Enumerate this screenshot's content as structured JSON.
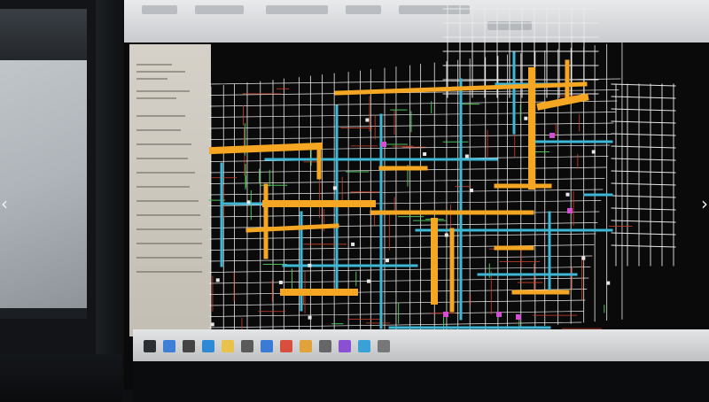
{
  "scene": {
    "description_label": "CAD MEP layout",
    "colors": {
      "duct_orange": "#f5a623",
      "pipe_cyan": "#3fb8d6",
      "grid_white": "#e8e8e8",
      "wire_red": "#d2422c",
      "wire_green": "#4cc25a",
      "wire_magenta": "#d24fd1",
      "screen_bg": "#0a0a0a"
    }
  },
  "navigation": {
    "prev_icon": "chevron-left-icon",
    "next_icon": "chevron-right-icon",
    "prev_glyph": "‹",
    "next_glyph": "›"
  },
  "taskbar": {
    "icons": [
      "start-icon",
      "search-icon",
      "task-view-icon",
      "edge-icon",
      "folder-icon",
      "store-icon",
      "mail-icon",
      "cad-icon",
      "chrome-icon",
      "settings-icon",
      "app-icon",
      "photos-icon",
      "app2-icon"
    ]
  }
}
